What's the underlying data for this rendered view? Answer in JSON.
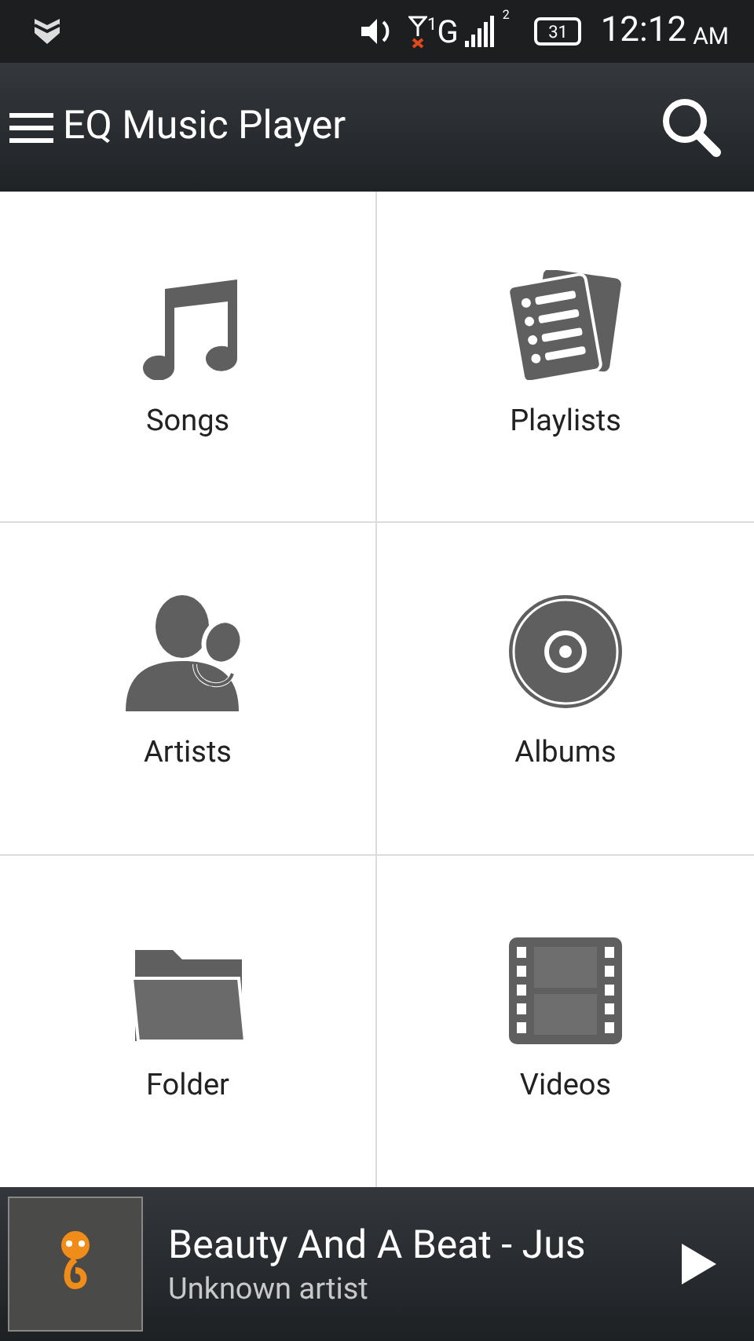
{
  "status_bar": {
    "network_sim": "1",
    "network_type": "G",
    "signal_sim": "2",
    "battery": "31",
    "time": "12:12",
    "ampm": "AM"
  },
  "app_bar": {
    "title": "EQ Music Player"
  },
  "categories": [
    {
      "kind": "songs",
      "label": "Songs"
    },
    {
      "kind": "playlists",
      "label": "Playlists"
    },
    {
      "kind": "artists",
      "label": "Artists"
    },
    {
      "kind": "albums",
      "label": "Albums"
    },
    {
      "kind": "folder",
      "label": "Folder"
    },
    {
      "kind": "videos",
      "label": "Videos"
    }
  ],
  "now_playing": {
    "title": "Beauty And A Beat - Jus",
    "artist": "Unknown artist"
  }
}
